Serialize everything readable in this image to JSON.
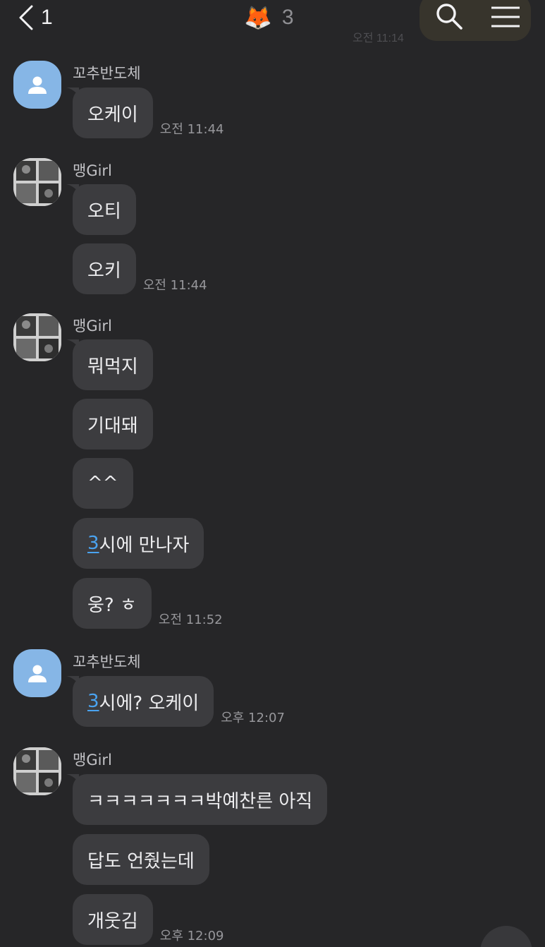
{
  "header": {
    "back_count": "1",
    "title_emoji": "🦊",
    "member_count": "3",
    "ghost_time": "오전 11:14"
  },
  "messages": [
    {
      "sender": "꼬추반도체",
      "avatar": "default-profile-icon",
      "bubbles": [
        "오케이"
      ],
      "time": "오전 11:44"
    },
    {
      "sender": "맹Girl",
      "avatar": "photo-profile",
      "bubbles": [
        "오티",
        "오키"
      ],
      "time": "오전 11:44"
    },
    {
      "sender": "맹Girl",
      "avatar": "photo-profile",
      "bubbles": [
        "뭐먹지",
        "기대돼",
        "^^",
        "시에 만나자",
        "웅? ㅎ"
      ],
      "link_prefix": "3",
      "time": "오전 11:52"
    },
    {
      "sender": "꼬추반도체",
      "avatar": "default-profile-icon",
      "bubbles": [
        "시에? 오케이"
      ],
      "link_prefix": "3",
      "time": "오후 12:07"
    },
    {
      "sender": "맹Girl",
      "avatar": "photo-profile",
      "bubbles": [
        "ㅋㅋㅋㅋㅋㅋㅋ박예찬른 아직",
        "답도 언줬는데",
        "개웃김"
      ],
      "time": "오후 12:09"
    }
  ],
  "colors": {
    "background": "#262628",
    "bubble": "#3c3c3f",
    "link": "#4aa3f0",
    "default_avatar": "#86b6e6"
  }
}
